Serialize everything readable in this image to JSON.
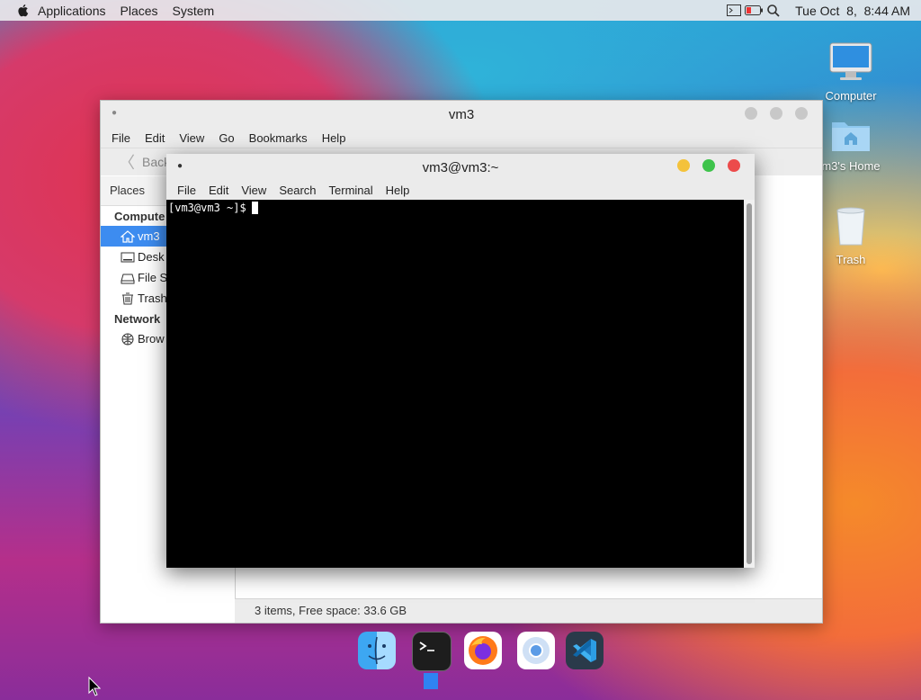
{
  "menubar": {
    "items": [
      "Applications",
      "Places",
      "System"
    ],
    "clock": "Tue Oct  8,  8:44 AM"
  },
  "desktop": {
    "icons": [
      "Computer",
      "m3's Home",
      "Trash"
    ]
  },
  "file_manager": {
    "title": "vm3",
    "menus": [
      "File",
      "Edit",
      "View",
      "Go",
      "Bookmarks",
      "Help"
    ],
    "back_label": "Back",
    "places_label": "Places",
    "computer_section": "Compute",
    "items": [
      "vm3",
      "Desk",
      "File S",
      "Trash"
    ],
    "network_section": "Network",
    "network_items": [
      "Brow"
    ],
    "status": "3 items, Free space: 33.6 GB"
  },
  "terminal": {
    "title": "vm3@vm3:~",
    "menus": [
      "File",
      "Edit",
      "View",
      "Search",
      "Terminal",
      "Help"
    ],
    "prompt": "[vm3@vm3 ~]$"
  },
  "dock": {
    "apps": [
      "finder-icon",
      "terminal-icon",
      "firefox-icon",
      "chromium-icon",
      "vscode-icon"
    ]
  },
  "colors": {
    "selection": "#3d8cf0",
    "close": "#ec4b4b",
    "minimize": "#f4c23b",
    "maximize": "#3ec34b"
  }
}
